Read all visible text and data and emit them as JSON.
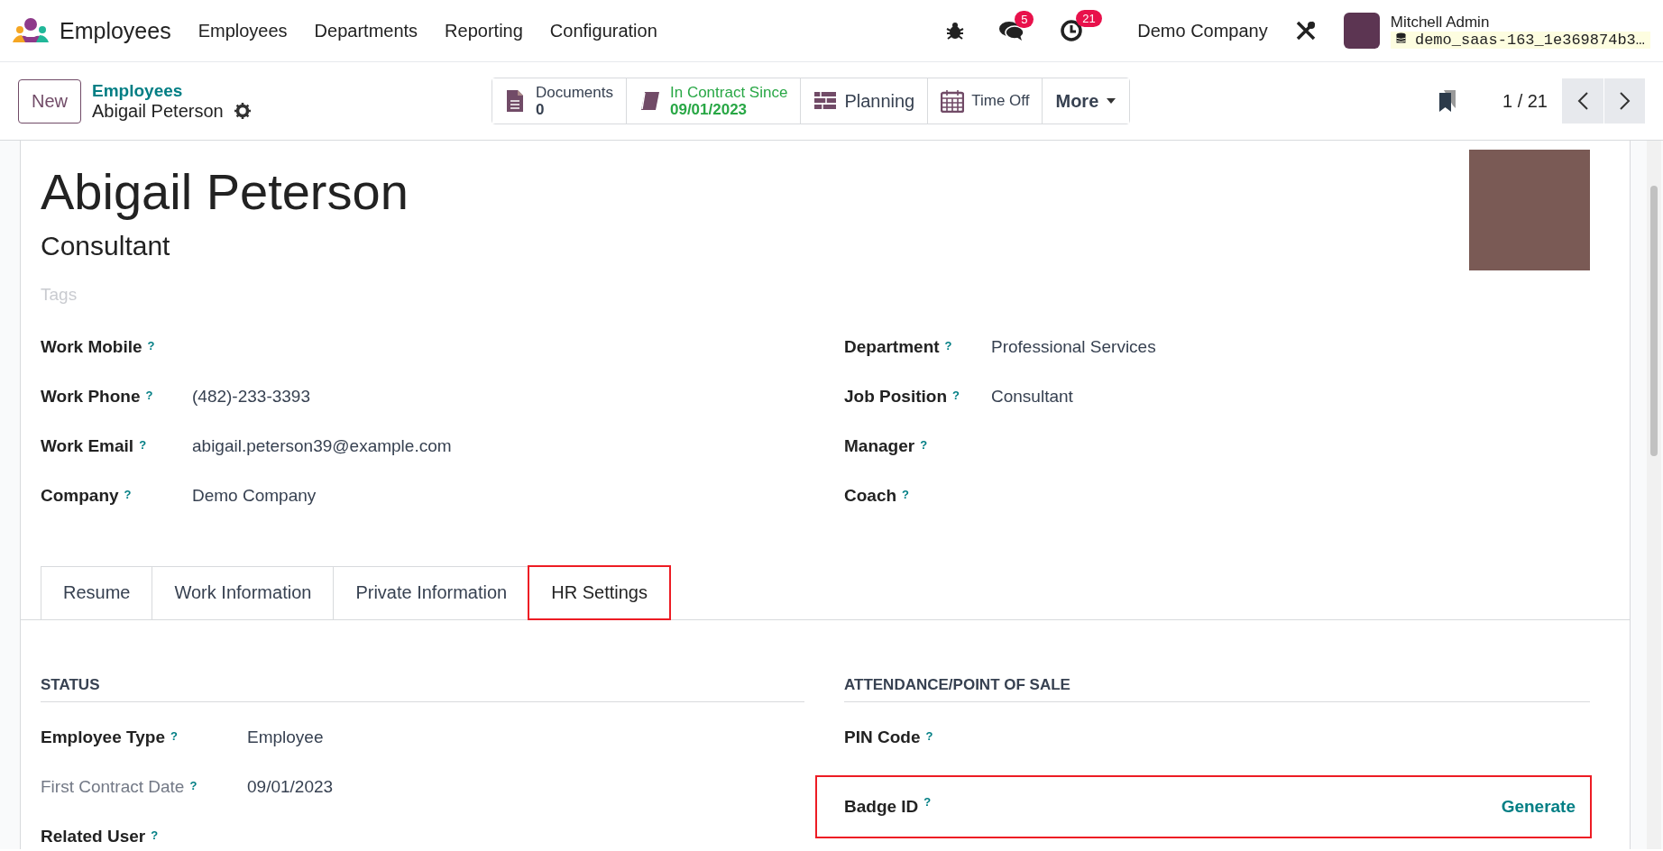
{
  "navbar": {
    "app_name": "Employees",
    "menu": [
      "Employees",
      "Departments",
      "Reporting",
      "Configuration"
    ],
    "messages_count": "5",
    "activities_count": "21",
    "company": "Demo Company",
    "user": {
      "name": "Mitchell Admin",
      "database": "demo_saas-163_1e369874b3…"
    }
  },
  "control_panel": {
    "new_button": "New",
    "breadcrumb": "Employees",
    "record": "Abigail Peterson",
    "smart_buttons": [
      {
        "kind": "stat",
        "label": "Documents",
        "value": "0"
      },
      {
        "kind": "stat_success",
        "label": "In Contract Since",
        "value": "09/01/2023"
      },
      {
        "kind": "plain",
        "label": "Planning"
      },
      {
        "kind": "plain",
        "label": "Time Off"
      },
      {
        "kind": "dropdown",
        "label": "More"
      }
    ],
    "pager": "1 / 21"
  },
  "employee": {
    "name": "Abigail Peterson",
    "job_title": "Consultant",
    "tags_placeholder": "Tags"
  },
  "fields_left": [
    {
      "label": "Work Mobile",
      "help": "?"
    },
    {
      "label": "Work Phone",
      "help": "?",
      "value": "(482)-233-3393"
    },
    {
      "label": "Work Email",
      "help": "?",
      "value": "abigail.peterson39@example.com"
    },
    {
      "label": "Company",
      "help": "?",
      "value": "Demo Company"
    }
  ],
  "fields_right": [
    {
      "label": "Department",
      "help": "?",
      "value": "Professional Services"
    },
    {
      "label": "Job Position",
      "help": "?",
      "value": "Consultant"
    },
    {
      "label": "Manager",
      "help": "?"
    },
    {
      "label": "Coach",
      "help": "?"
    }
  ],
  "tabs": [
    {
      "label": "Resume",
      "selected": false,
      "highlighted": false
    },
    {
      "label": "Work Information",
      "selected": false,
      "highlighted": false
    },
    {
      "label": "Private Information",
      "selected": false,
      "highlighted": false
    },
    {
      "label": "HR Settings",
      "selected": true,
      "highlighted": true
    }
  ],
  "sections": [
    {
      "title": "STATUS",
      "fields": [
        {
          "label": "Employee Type",
          "help": "?",
          "value": "Employee",
          "muted": false,
          "highlighted": false
        },
        {
          "label": "First Contract Date",
          "help": "?",
          "value": "09/01/2023",
          "muted": true,
          "highlighted": false
        },
        {
          "label": "Related User",
          "help": "?",
          "muted": false,
          "highlighted": false
        }
      ]
    },
    {
      "title": "ATTENDANCE/POINT OF SALE",
      "fields": [
        {
          "label": "PIN Code",
          "help": "?",
          "muted": false,
          "highlighted": false
        },
        {
          "label": "Badge ID",
          "help": "?",
          "action": "Generate",
          "muted": false,
          "highlighted": true
        }
      ]
    }
  ]
}
